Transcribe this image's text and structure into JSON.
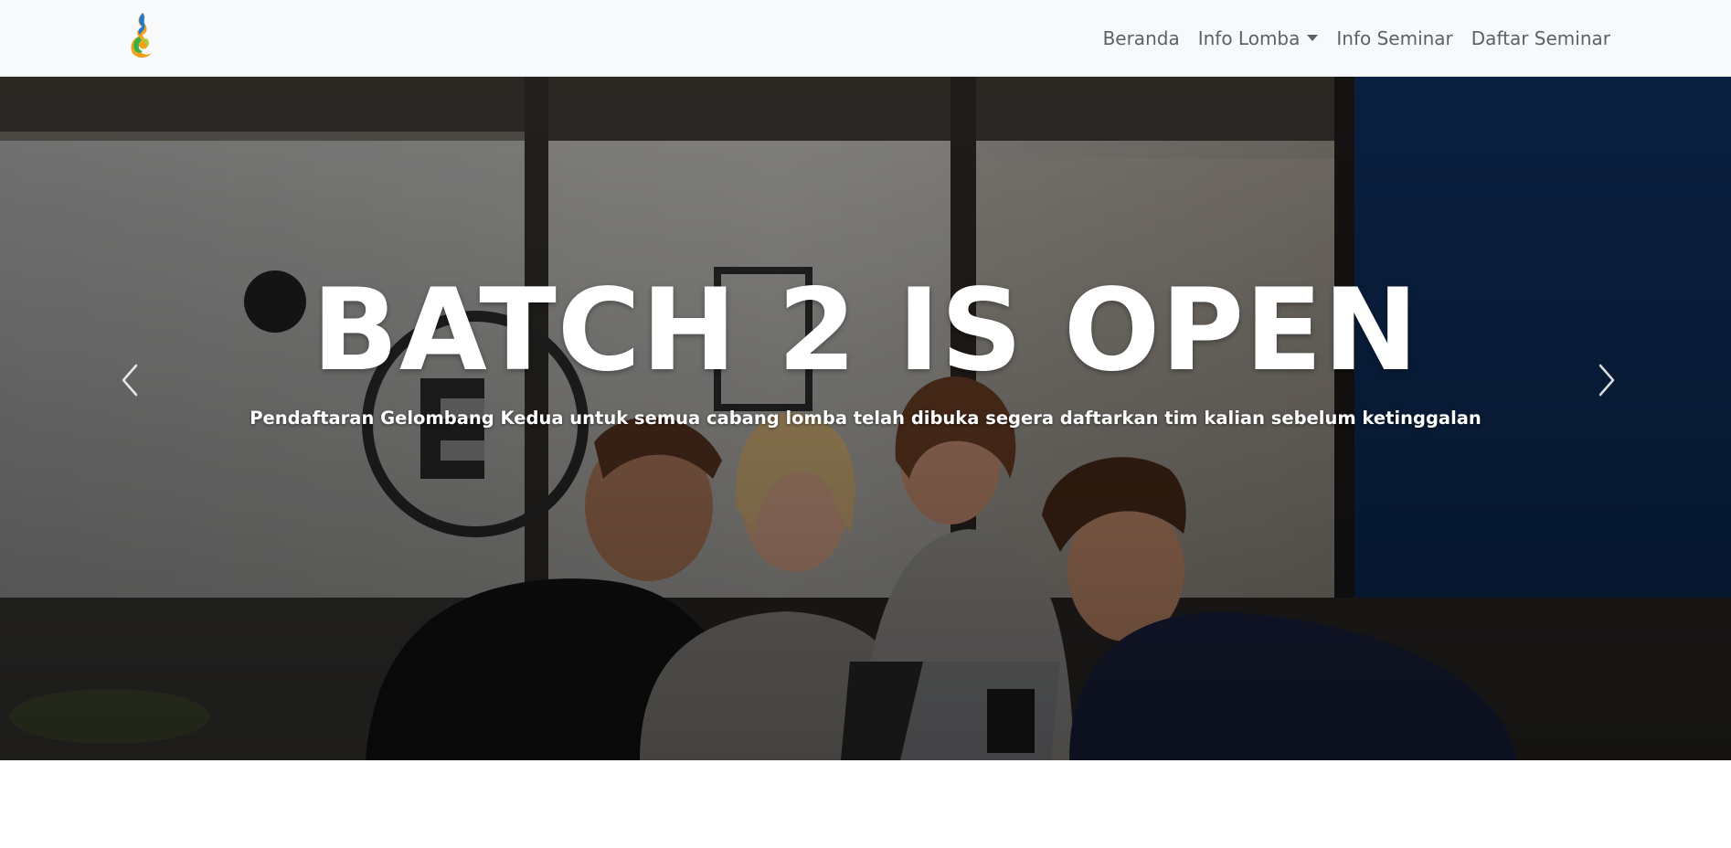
{
  "nav": {
    "links": [
      {
        "label": "Beranda"
      },
      {
        "label": "Info Lomba"
      },
      {
        "label": "Info Seminar"
      },
      {
        "label": "Daftar Seminar"
      }
    ]
  },
  "hero": {
    "title": "BATCH 2 IS OPEN",
    "subtitle": "Pendaftaran Gelombang Kedua untuk semua cabang lomba telah dibuka segera daftarkan tim kalian sebelum ketinggalan"
  },
  "icons": {
    "logo": "flame-logo-icon",
    "dropdown": "caret-down-icon",
    "prev": "chevron-left-icon",
    "next": "chevron-right-icon"
  },
  "colors": {
    "navbar_bg": "#f8f9fa",
    "nav_text": "#5c6166",
    "caption_text": "#ffffff"
  }
}
